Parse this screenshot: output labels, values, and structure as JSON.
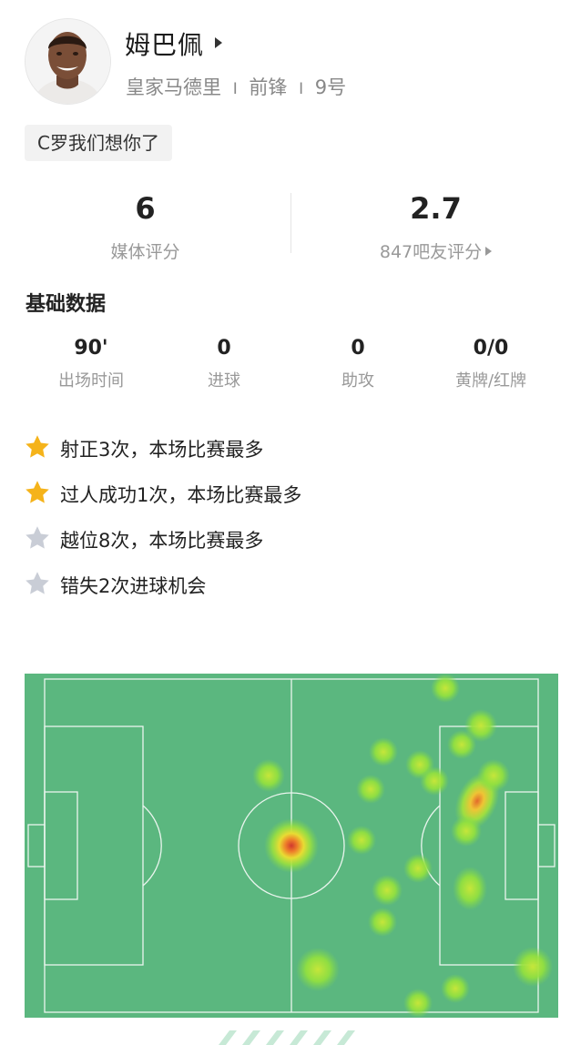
{
  "player": {
    "name": "姆巴佩",
    "club": "皇家马德里",
    "position": "前锋",
    "number": "9号",
    "sep": "I"
  },
  "tag": "C罗我们想你了",
  "ratings": {
    "media": {
      "value": "6",
      "label": "媒体评分"
    },
    "fans": {
      "value": "2.7",
      "label": "847吧友评分"
    }
  },
  "basic": {
    "title": "基础数据",
    "stats": [
      {
        "value": "90'",
        "label": "出场时间"
      },
      {
        "value": "0",
        "label": "进球"
      },
      {
        "value": "0",
        "label": "助攻"
      },
      {
        "value": "0/0",
        "label": "黄牌/红牌"
      }
    ]
  },
  "highlights": [
    {
      "text": "射正3次，本场比赛最多",
      "icon": "star-gold-icon",
      "color": "#F5B31A"
    },
    {
      "text": "过人成功1次，本场比赛最多",
      "icon": "star-gold-icon",
      "color": "#F5B31A"
    },
    {
      "text": "越位8次，本场比赛最多",
      "icon": "star-gray-icon",
      "color": "#C9CDD6"
    },
    {
      "text": "错失2次进球机会",
      "icon": "star-gray-icon",
      "color": "#C9CDD6"
    }
  ],
  "heatmap": {
    "pitch_color": "#5BB77F",
    "line_color": "#EAF5EE"
  }
}
